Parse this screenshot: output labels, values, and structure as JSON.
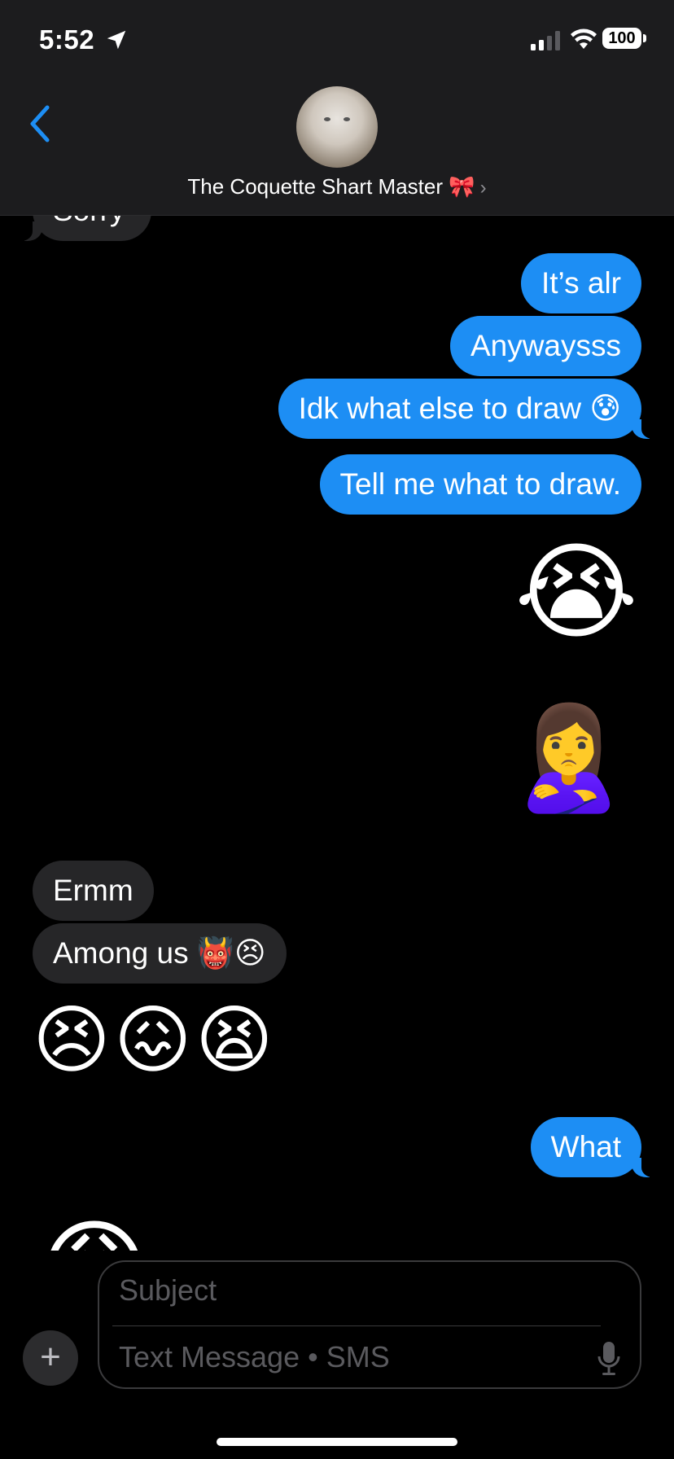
{
  "status_bar": {
    "time": "5:52",
    "battery": "100"
  },
  "header": {
    "contact_name": "The Coquette Shart Master 🎀",
    "chevron": "›"
  },
  "messages": {
    "partial_top": "Sorry",
    "out_1": "It’s alr",
    "out_2": "Anywaysss",
    "out_3": "Idk what else to draw 😰",
    "out_4": "Tell me what to draw.",
    "out_emoji_1": "😭",
    "out_emoji_2": "🙎‍♀️",
    "in_1": "Ermm",
    "in_2": "Among us 👹😣",
    "in_emoji": "😣😖😫",
    "out_5": "What",
    "partial_bottom_emoji": "😩"
  },
  "composer": {
    "plus_label": "+",
    "subject_placeholder": "Subject",
    "text_placeholder": "Text Message • SMS"
  },
  "icons": [
    "location-arrow-icon",
    "signal-icon",
    "wifi-icon",
    "battery-icon",
    "back-chevron-icon",
    "mic-icon",
    "plus-icon"
  ]
}
